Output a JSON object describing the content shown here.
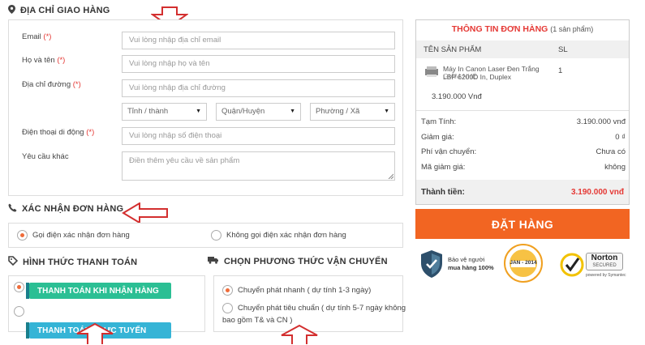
{
  "shipping": {
    "title": "ĐỊA CHỈ GIAO HÀNG",
    "email_label": "Email",
    "email_placeholder": "Vui lòng nhập địa chỉ email",
    "name_label": "Họ và tên",
    "name_placeholder": "Vui lòng nhập họ và tên",
    "address_label": "Địa chỉ đường",
    "address_placeholder": "Vui lòng nhập địa chỉ đường",
    "province": "Tỉnh / thành",
    "district": "Quận/Huyện",
    "ward": "Phường / Xã",
    "phone_label": "Điện thoại di động",
    "phone_placeholder": "Vui lòng nhập số điện thoại",
    "other_label": "Yêu cầu khác",
    "other_placeholder": "Điền thêm yêu cầu về sản phẩm",
    "required_mark": "(*)"
  },
  "confirm": {
    "title": "XÁC NHẬN ĐƠN HÀNG",
    "option_call": "Gọi điện xác nhận đơn hàng",
    "option_nocall": "Không gọi điện xác nhận đơn hàng"
  },
  "payment": {
    "title": "HÌNH THỨC THANH TOÁN",
    "cod": "THANH TOÁN KHI NHẬN HÀNG",
    "online": "THANH TOÁN TRỰC TUYẾN"
  },
  "delivery": {
    "title": "CHỌN PHƯƠNG THỨC VẬN CHUYỂN",
    "fast": "Chuyển phát nhanh ( dự tính 1-3 ngày)",
    "standard_line1": "Chuyển phát tiêu chuẩn ( dự tính 5-7 ngày không",
    "standard_line2": "bao gồm T& và CN )"
  },
  "order": {
    "title": "THÔNG TIN ĐƠN HÀNG",
    "count": "(1 sản phẩm)",
    "col_product": "TÊN SẢN PHẨM",
    "col_qty": "SL",
    "product_name_1": "Máy In Canon Laser Đen Trắng",
    "product_name_2": "LBP 6200D In, Duplex",
    "product_overlap": "GIẢM NHÉ",
    "product_qty": "1",
    "product_price": "3.190.000 Vnđ",
    "subtotal_label": "Tạm Tính:",
    "subtotal_value": "3.190.000 vnđ",
    "discount_label": "Giảm giá:",
    "discount_value": "0 ₫",
    "shipping_label": "Phí vận chuyển:",
    "shipping_value": "Chưa có",
    "coupon_label": "Mã giảm giá:",
    "coupon_value": "không",
    "total_label": "Thành tiền:",
    "total_value": "3.190.000 vnđ"
  },
  "place_order": "ĐẶT HÀNG",
  "badges": {
    "protect_1": "Bảo vệ người",
    "protect_2": "mua hàng 100%",
    "pci_date": "JAN - 2014",
    "norton_1": "Norton",
    "norton_2": "SECURED",
    "norton_3": "powered by Symantec"
  },
  "colors": {
    "accent": "#f26522",
    "required": "#e53935",
    "title_red": "#e53935",
    "arrow": "#d32f2f"
  }
}
